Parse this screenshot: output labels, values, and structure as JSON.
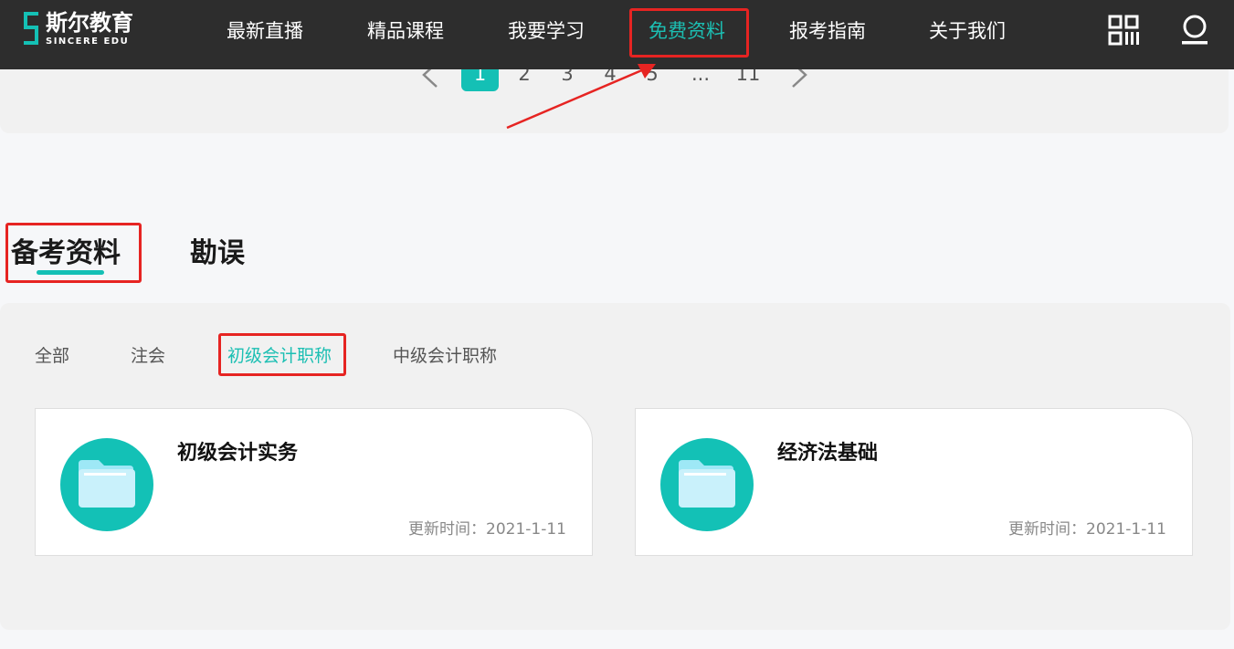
{
  "header": {
    "logo_cn": "斯尔教育",
    "logo_en": "SINCERE EDU",
    "nav": [
      {
        "label": "最新直播"
      },
      {
        "label": "精品课程"
      },
      {
        "label": "我要学习"
      },
      {
        "label": "免费资料",
        "active": true
      },
      {
        "label": "报考指南"
      },
      {
        "label": "关于我们"
      }
    ],
    "icons": [
      "qr-code-icon",
      "user-icon"
    ]
  },
  "pagination": {
    "prev_icon": "chevron-left-icon",
    "pages": [
      "1",
      "2",
      "3",
      "4",
      "5",
      "...",
      "11"
    ],
    "current": "1",
    "next_icon": "chevron-right-icon"
  },
  "section_tabs": [
    {
      "label": "备考资料",
      "active": true
    },
    {
      "label": "勘误"
    }
  ],
  "filters": [
    {
      "label": "全部"
    },
    {
      "label": "注会"
    },
    {
      "label": "初级会计职称",
      "active": true
    },
    {
      "label": "中级会计职称"
    }
  ],
  "cards": [
    {
      "title": "初级会计实务",
      "date": "更新时间：2021-1-11",
      "icon": "folder-icon"
    },
    {
      "title": "经济法基础",
      "date": "更新时间：2021-1-11",
      "icon": "folder-icon"
    }
  ],
  "colors": {
    "accent": "#1cbfb3",
    "header_bg": "#2d2d2d",
    "annotation_red": "#e62422",
    "panel_bg": "#f1f1f1"
  }
}
